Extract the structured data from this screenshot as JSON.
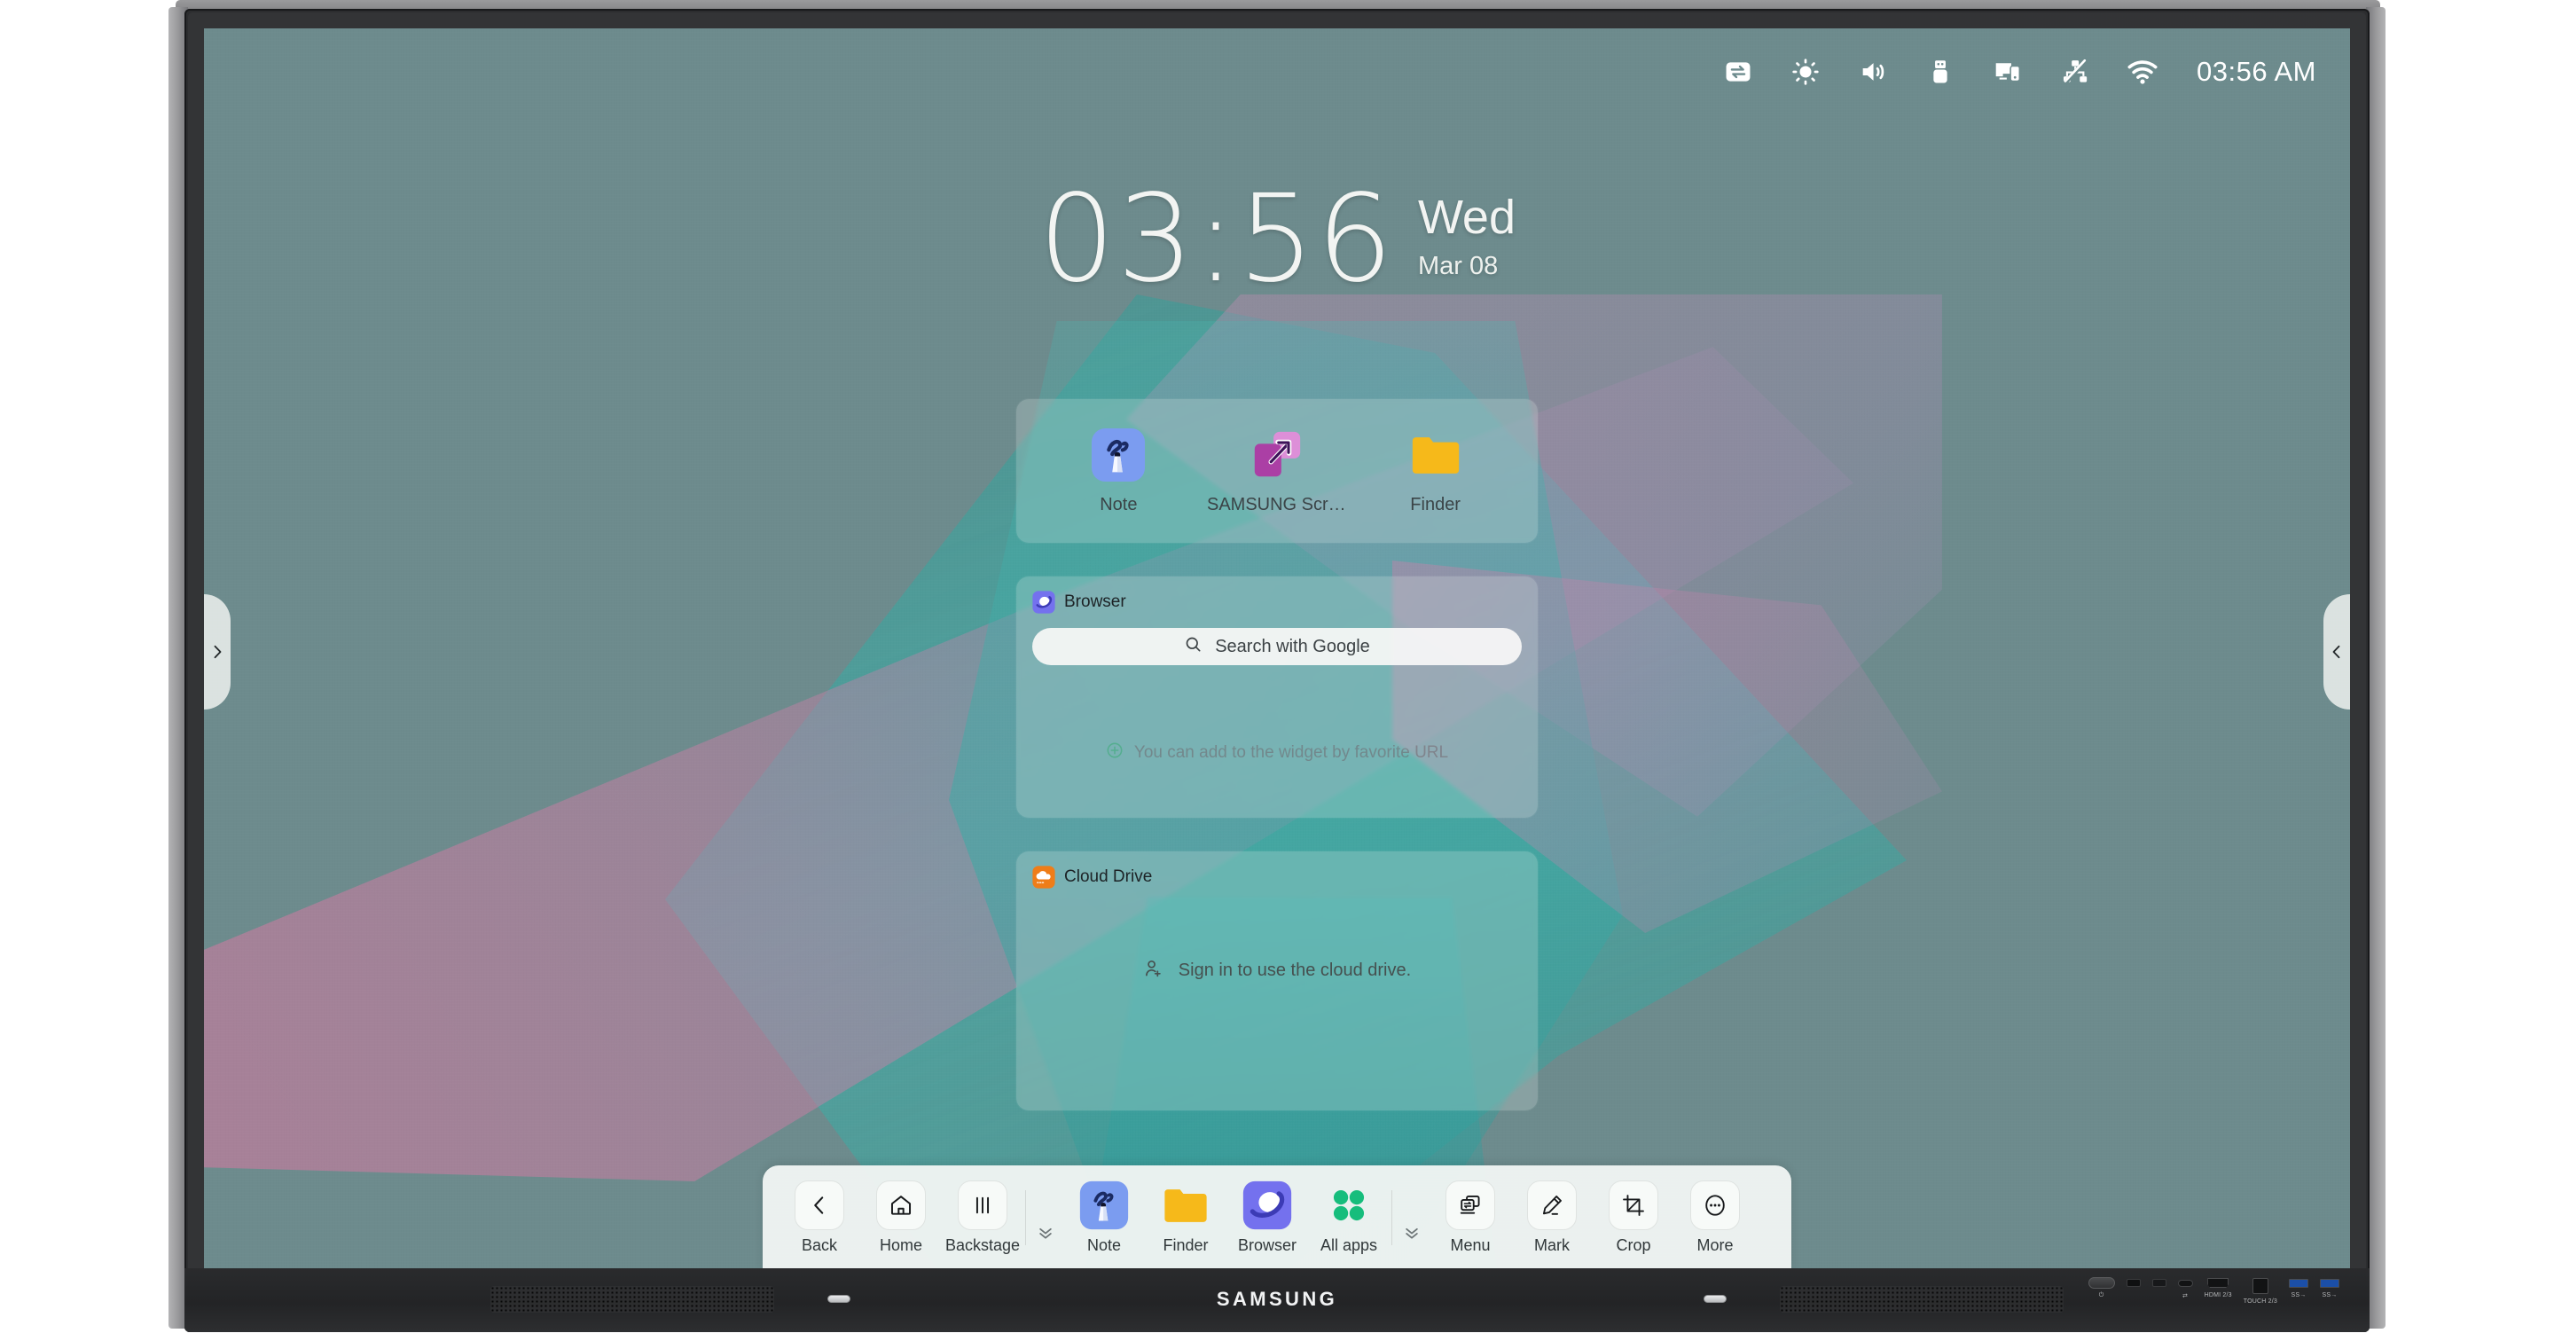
{
  "device": {
    "brand": "SAMSUNG"
  },
  "statusbar": {
    "icons": [
      {
        "name": "source-switch-icon",
        "label": "Source"
      },
      {
        "name": "brightness-icon",
        "label": "Brightness"
      },
      {
        "name": "volume-icon",
        "label": "Volume"
      },
      {
        "name": "usb-drive-icon",
        "label": "USB"
      },
      {
        "name": "screen-share-icon",
        "label": "Screen share"
      },
      {
        "name": "network-disconnected-icon",
        "label": "Network disconnected"
      },
      {
        "name": "wifi-icon",
        "label": "Wi-Fi"
      }
    ],
    "time": "03:56 AM"
  },
  "clock": {
    "time": "03:56",
    "weekday": "Wed",
    "date": "Mar 08"
  },
  "shortcuts_widget": {
    "items": [
      {
        "label": "Note",
        "icon": "note-app-icon"
      },
      {
        "label": "SAMSUNG Screen...",
        "icon": "samsung-screen-app-icon"
      },
      {
        "label": "Finder",
        "icon": "finder-app-icon"
      }
    ]
  },
  "browser_widget": {
    "title": "Browser",
    "icon": "browser-app-icon",
    "search_placeholder": "Search with Google",
    "hint": "You can add to the widget by favorite URL"
  },
  "cloud_widget": {
    "title": "Cloud Drive",
    "icon": "cloud-drive-app-icon",
    "message": "Sign in to use the cloud drive."
  },
  "dock": {
    "nav": [
      {
        "label": "Back",
        "icon": "chevron-left-icon"
      },
      {
        "label": "Home",
        "icon": "home-icon"
      },
      {
        "label": "Backstage",
        "icon": "backstage-icon"
      }
    ],
    "apps": [
      {
        "label": "Note",
        "icon": "note-app-icon"
      },
      {
        "label": "Finder",
        "icon": "finder-app-icon"
      },
      {
        "label": "Browser",
        "icon": "browser-app-icon"
      },
      {
        "label": "All apps",
        "icon": "all-apps-icon"
      }
    ],
    "tools": [
      {
        "label": "Menu",
        "icon": "menu-window-icon"
      },
      {
        "label": "Mark",
        "icon": "pen-mark-icon"
      },
      {
        "label": "Crop",
        "icon": "crop-icon"
      },
      {
        "label": "More",
        "icon": "more-dots-icon"
      }
    ],
    "collapse_icon": "double-chevron-down-icon"
  },
  "edge_handles": {
    "left": "chevron-right-icon",
    "right": "chevron-left-icon"
  },
  "ports": [
    {
      "label": "",
      "type": "power-button"
    },
    {
      "label": "",
      "type": "blank-slot"
    },
    {
      "label": "",
      "type": "sd-slot"
    },
    {
      "label": "",
      "type": "usb-c"
    },
    {
      "label": "HDMI 2/3",
      "type": "hdmi"
    },
    {
      "label": "TOUCH 2/3",
      "type": "usb-b"
    },
    {
      "label": "",
      "type": "usb-a"
    },
    {
      "label": "",
      "type": "usb-a"
    }
  ],
  "colors": {
    "wallpaper_base": "#6d8b8d",
    "accent_teal": "#3eb2aa",
    "accent_pink": "#d678a0",
    "note_blue": "#7b9cf0",
    "finder_yellow": "#f6b91a",
    "browser_purple": "#7471ee",
    "allapps_green": "#16bd7c",
    "screen_purple": "#a8439e"
  }
}
